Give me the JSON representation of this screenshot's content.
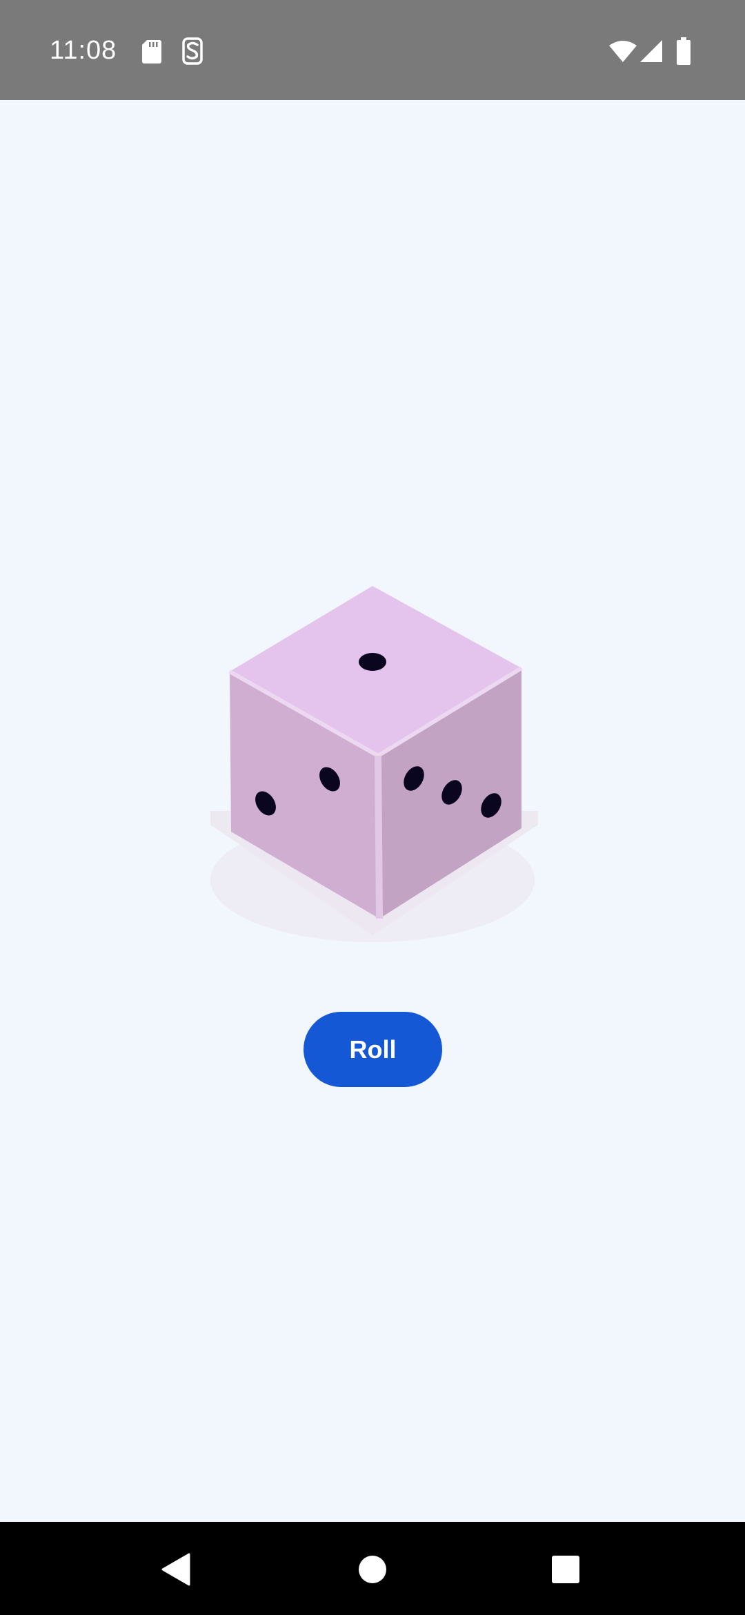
{
  "status_bar": {
    "time": "11:08",
    "icons_left": [
      "sd-card-icon",
      "screen-record-icon"
    ],
    "icons_right": [
      "wifi-icon",
      "cell-signal-icon",
      "battery-icon"
    ]
  },
  "dice": {
    "top_face_pips": 1,
    "left_face_pips": 2,
    "right_face_pips": 3,
    "face_color": "#e3c3ec"
  },
  "roll_button": {
    "label": "Roll",
    "color": "#1558d6"
  },
  "nav_bar": {
    "buttons": [
      "back-icon",
      "home-icon",
      "recents-icon"
    ]
  }
}
